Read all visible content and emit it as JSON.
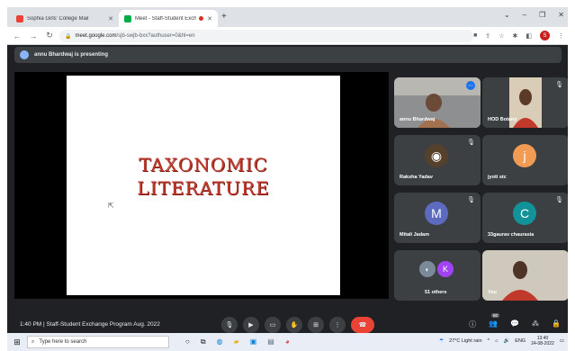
{
  "browser": {
    "tabs": [
      {
        "title": "Sophia Girls' College Mail",
        "active": false
      },
      {
        "title": "Meet - Staff-Student Exchan",
        "active": true
      }
    ],
    "new_tab": "+",
    "url_host": "meet.google.com",
    "url_path": "/sjb-swjb-bxx?authuser=0&hl=en",
    "profile_initial": "S"
  },
  "meet": {
    "presenting_banner": "annu Bhardwaj is presenting",
    "slide_title_line1": "TAXONOMIC",
    "slide_title_line2": "LITERATURE",
    "participants": [
      {
        "name": "annu Bhardwaj"
      },
      {
        "name": "HOD Botany"
      },
      {
        "name": "Raksha Yadav"
      },
      {
        "name": "jyoti stc",
        "initial": "j",
        "color": "#f29b55"
      },
      {
        "name": "Mitali Jadam",
        "initial": "M",
        "color": "#5c6bc0"
      },
      {
        "name": "33gaurav chaurasia",
        "initial": "C",
        "color": "#12939a"
      },
      {
        "name": "51 others",
        "initial": "K",
        "color": "#a142f4"
      },
      {
        "name": "You"
      }
    ],
    "time": "1:40 PM",
    "meeting_title": "Staff-Student Exchange Program Aug. 2022",
    "people_badge": "60"
  },
  "taskbar": {
    "search_placeholder": "Type here to search",
    "weather": "27°C Light rain",
    "lang": "ENG",
    "time": "13:40",
    "date": "24-08-2022"
  }
}
